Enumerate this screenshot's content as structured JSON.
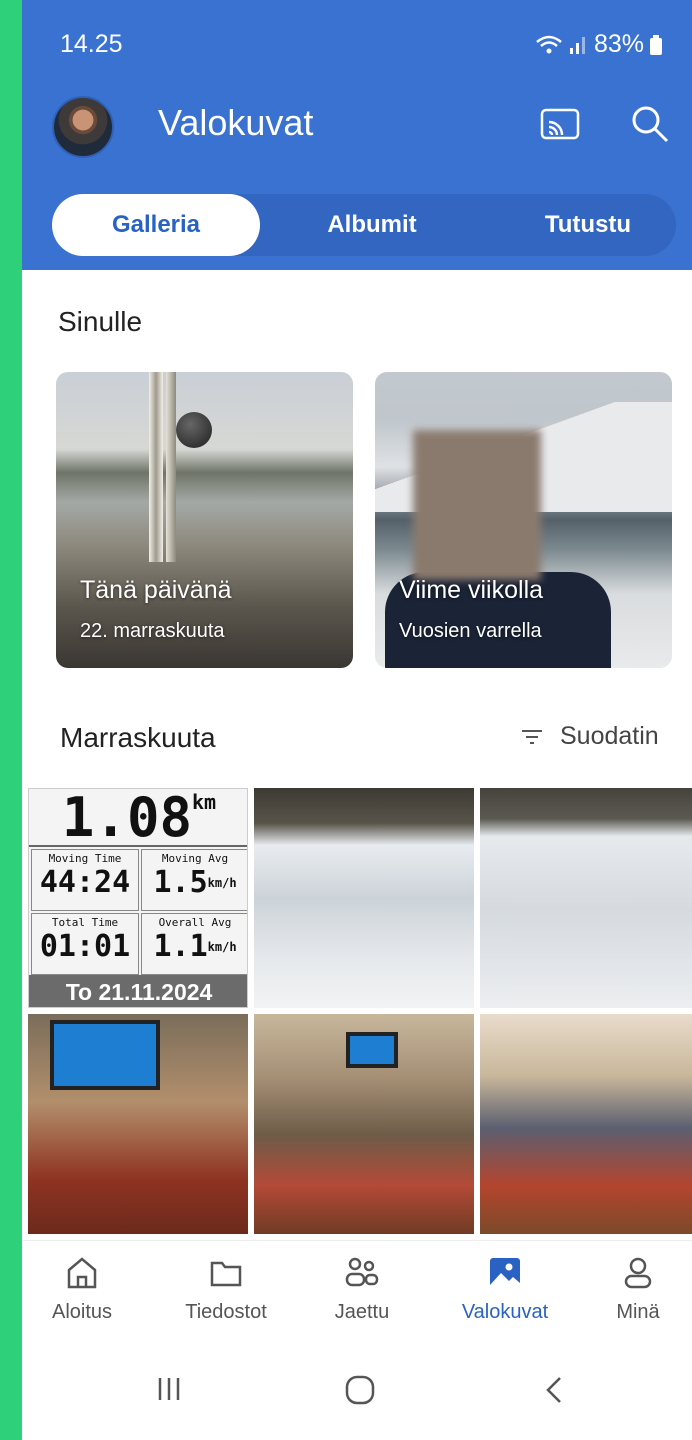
{
  "status_bar": {
    "time": "14.25",
    "battery": "83%"
  },
  "header": {
    "title": "Valokuvat"
  },
  "tabs": [
    {
      "label": "Galleria",
      "active": true
    },
    {
      "label": "Albumit",
      "active": false
    },
    {
      "label": "Tutustu",
      "active": false
    }
  ],
  "for_you": {
    "title": "Sinulle",
    "cards": [
      {
        "title": "Tänä päivänä",
        "subtitle": "22. marraskuuta"
      },
      {
        "title": "Viime viikolla",
        "subtitle": "Vuosien varrella"
      }
    ]
  },
  "month_section": {
    "title": "Marraskuuta",
    "filter_label": "Suodatin"
  },
  "gps_photo": {
    "distance": "1.08",
    "distance_unit": "km",
    "stats": [
      {
        "label": "Moving Time",
        "value": "44:24"
      },
      {
        "label": "Moving Avg",
        "value": "1.5",
        "unit": "km/h"
      },
      {
        "label": "Total Time",
        "value": "01:01"
      },
      {
        "label": "Overall Avg",
        "value": "1.1",
        "unit": "km/h"
      }
    ],
    "date": "To 21.11.2024"
  },
  "bottom_nav": [
    {
      "label": "Aloitus",
      "icon": "home-icon"
    },
    {
      "label": "Tiedostot",
      "icon": "folder-icon"
    },
    {
      "label": "Jaettu",
      "icon": "shared-icon"
    },
    {
      "label": "Valokuvat",
      "icon": "photos-icon",
      "active": true
    },
    {
      "label": "Minä",
      "icon": "profile-icon"
    }
  ],
  "colors": {
    "brand": "#3a72d2",
    "active_nav": "#2a62c4",
    "side_strip": "#2fd07a"
  }
}
